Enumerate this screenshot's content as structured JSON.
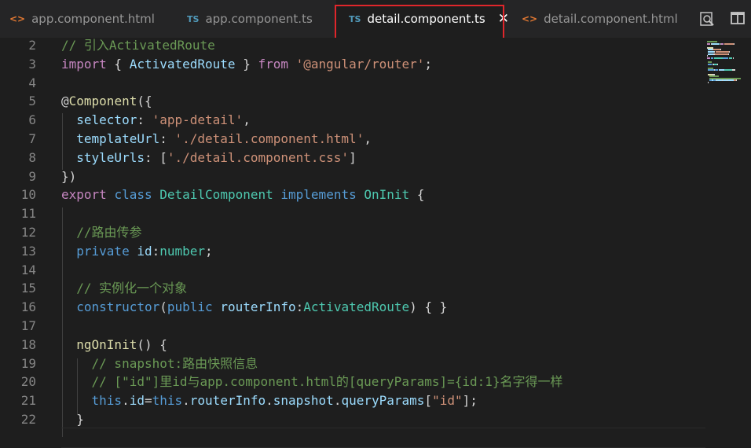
{
  "tabs": [
    {
      "icon": "<>",
      "label": "app.component.html",
      "active": false
    },
    {
      "icon": "TS",
      "label": "app.component.ts",
      "active": false
    },
    {
      "icon": "TS",
      "label": "detail.component.ts",
      "active": true,
      "close": "✕"
    },
    {
      "icon": "<>",
      "label": "detail.component.html",
      "active": false
    }
  ],
  "toolbar": {
    "open_preview_icon": "search-preview-icon",
    "split_editor_icon": "split-editor-icon"
  },
  "editor": {
    "line_numbers": [
      "2",
      "3",
      "4",
      "5",
      "6",
      "7",
      "8",
      "9",
      "10",
      "11",
      "12",
      "13",
      "14",
      "15",
      "16",
      "17",
      "18",
      "19",
      "20",
      "21",
      "22"
    ],
    "lines": [
      [
        {
          "t": "// 引入ActivatedRoute",
          "c": "cmt"
        }
      ],
      [
        {
          "t": "import",
          "c": "ctl"
        },
        {
          "t": " { ",
          "c": "pun"
        },
        {
          "t": "ActivatedRoute",
          "c": "prop"
        },
        {
          "t": " } ",
          "c": "pun"
        },
        {
          "t": "from",
          "c": "ctl"
        },
        {
          "t": " ",
          "c": "pun"
        },
        {
          "t": "'@angular/router'",
          "c": "str"
        },
        {
          "t": ";",
          "c": "pun"
        }
      ],
      [],
      [
        {
          "t": "@",
          "c": "pun"
        },
        {
          "t": "Component",
          "c": "fn"
        },
        {
          "t": "({",
          "c": "pun"
        }
      ],
      [
        {
          "t": "  selector",
          "c": "prop"
        },
        {
          "t": ": ",
          "c": "pun"
        },
        {
          "t": "'app-detail'",
          "c": "str"
        },
        {
          "t": ",",
          "c": "pun"
        }
      ],
      [
        {
          "t": "  templateUrl",
          "c": "prop"
        },
        {
          "t": ": ",
          "c": "pun"
        },
        {
          "t": "'./detail.component.html'",
          "c": "str"
        },
        {
          "t": ",",
          "c": "pun"
        }
      ],
      [
        {
          "t": "  styleUrls",
          "c": "prop"
        },
        {
          "t": ": [",
          "c": "pun"
        },
        {
          "t": "'./detail.component.css'",
          "c": "str"
        },
        {
          "t": "]",
          "c": "pun"
        }
      ],
      [
        {
          "t": "})",
          "c": "pun"
        }
      ],
      [
        {
          "t": "export",
          "c": "ctl"
        },
        {
          "t": " ",
          "c": "pun"
        },
        {
          "t": "class",
          "c": "kw"
        },
        {
          "t": " ",
          "c": "pun"
        },
        {
          "t": "DetailComponent",
          "c": "type"
        },
        {
          "t": " ",
          "c": "pun"
        },
        {
          "t": "implements",
          "c": "kw"
        },
        {
          "t": " ",
          "c": "pun"
        },
        {
          "t": "OnInit",
          "c": "type"
        },
        {
          "t": " {",
          "c": "pun"
        }
      ],
      [],
      [
        {
          "t": "  //路由传参",
          "c": "cmt"
        }
      ],
      [
        {
          "t": "  private",
          "c": "kw"
        },
        {
          "t": " ",
          "c": "pun"
        },
        {
          "t": "id",
          "c": "prop"
        },
        {
          "t": ":",
          "c": "pun"
        },
        {
          "t": "number",
          "c": "type"
        },
        {
          "t": ";",
          "c": "pun"
        }
      ],
      [],
      [
        {
          "t": "  // 实例化一个对象",
          "c": "cmt"
        }
      ],
      [
        {
          "t": "  constructor",
          "c": "kw"
        },
        {
          "t": "(",
          "c": "pun"
        },
        {
          "t": "public",
          "c": "kw"
        },
        {
          "t": " ",
          "c": "pun"
        },
        {
          "t": "routerInfo",
          "c": "prop"
        },
        {
          "t": ":",
          "c": "pun"
        },
        {
          "t": "ActivatedRoute",
          "c": "type"
        },
        {
          "t": ") { }",
          "c": "pun"
        }
      ],
      [],
      [
        {
          "t": "  ngOnInit",
          "c": "fn"
        },
        {
          "t": "() {",
          "c": "pun"
        }
      ],
      [
        {
          "t": "    // snapshot:路由快照信息",
          "c": "cmt"
        }
      ],
      [
        {
          "t": "    // [\"id\"]里id与app.component.html的[queryParams]={id:1}名字得一样",
          "c": "cmt"
        }
      ],
      [
        {
          "t": "    this",
          "c": "kw"
        },
        {
          "t": ".",
          "c": "pun"
        },
        {
          "t": "id",
          "c": "prop"
        },
        {
          "t": "=",
          "c": "pun"
        },
        {
          "t": "this",
          "c": "kw"
        },
        {
          "t": ".",
          "c": "pun"
        },
        {
          "t": "routerInfo",
          "c": "prop"
        },
        {
          "t": ".",
          "c": "pun"
        },
        {
          "t": "snapshot",
          "c": "prop"
        },
        {
          "t": ".",
          "c": "pun"
        },
        {
          "t": "queryParams",
          "c": "prop"
        },
        {
          "t": "[",
          "c": "pun"
        },
        {
          "t": "\"id\"",
          "c": "str"
        },
        {
          "t": "];",
          "c": "pun"
        }
      ],
      [
        {
          "t": "  }",
          "c": "pun"
        }
      ]
    ]
  }
}
